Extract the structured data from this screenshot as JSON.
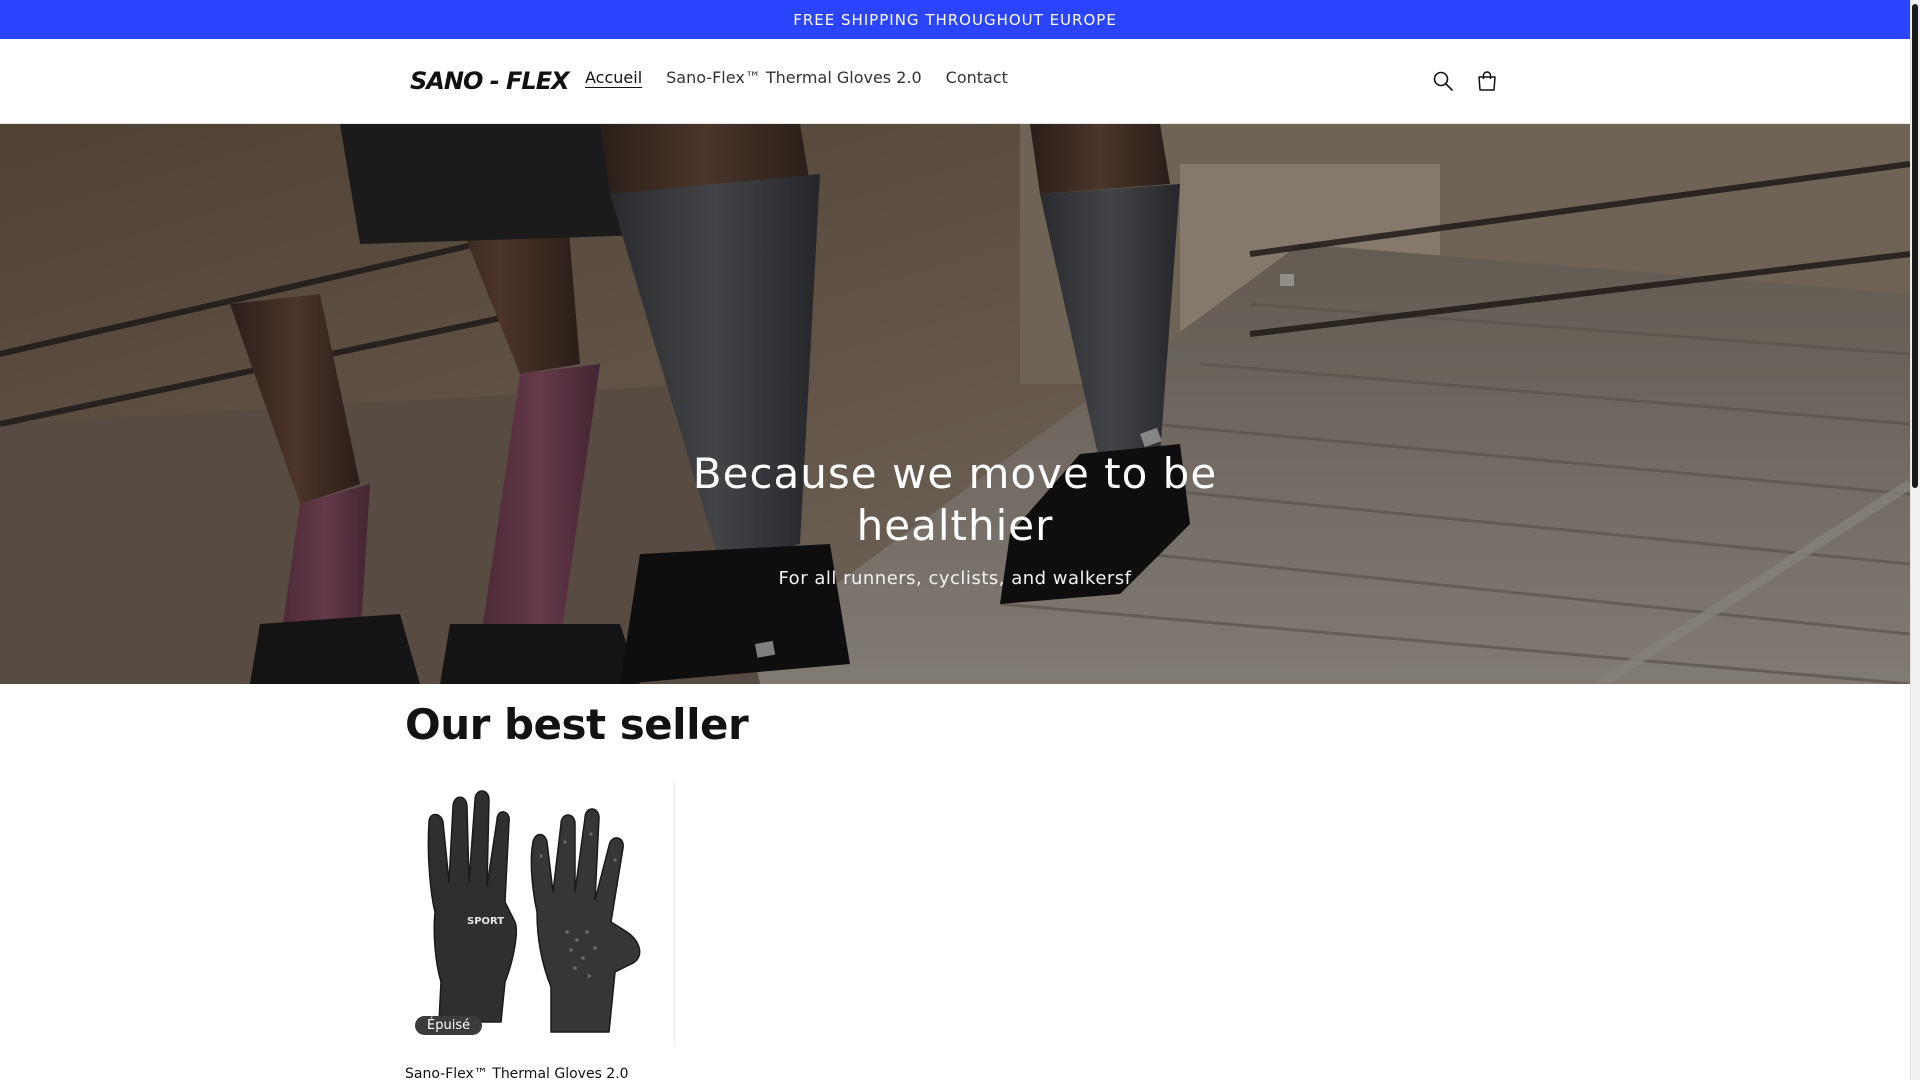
{
  "announcement": {
    "text": "FREE SHIPPING THROUGHOUT EUROPE",
    "color": "#2a44ff"
  },
  "header": {
    "logo_text": "SANO - FLEX",
    "nav": [
      {
        "label": "Accueil",
        "active": true
      },
      {
        "label": "Sano-Flex™ Thermal Gloves 2.0",
        "active": false
      },
      {
        "label": "Contact",
        "active": false
      }
    ],
    "icons": [
      "search-icon",
      "cart-icon"
    ]
  },
  "hero": {
    "title": "Because we move to be healthier",
    "subtitle": "For all runners, cyclists, and walkersf"
  },
  "best_seller": {
    "title": "Our best seller",
    "product": {
      "title": "Sano-Flex™ Thermal Gloves 2.0",
      "badge": "Épuisé",
      "logo_text": "SPORT"
    }
  }
}
